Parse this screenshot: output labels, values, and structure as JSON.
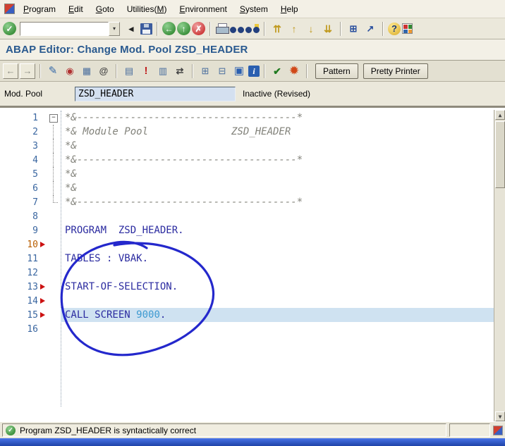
{
  "menu_bar": {
    "items": [
      {
        "label": "Program",
        "u": 0
      },
      {
        "label": "Edit",
        "u": 0
      },
      {
        "label": "Goto",
        "u": 0
      },
      {
        "label": "Utilities(M)",
        "u": 10
      },
      {
        "label": "Environment",
        "u": 0
      },
      {
        "label": "System",
        "u": 0
      },
      {
        "label": "Help",
        "u": 0
      }
    ]
  },
  "toolbar": {
    "enter_glyph": "✓",
    "command_field_value": "",
    "command_dropdown_glyph": "▾",
    "icons": [
      {
        "name": "collapse-command-field-icon",
        "glyph": "◂",
        "cls": "plain"
      },
      {
        "name": "save-icon",
        "cls": "floppy"
      },
      {
        "sep": true
      },
      {
        "name": "back-icon",
        "glyph": "←",
        "cls": "circle green"
      },
      {
        "name": "exit-icon",
        "glyph": "↑",
        "cls": "circle green"
      },
      {
        "name": "cancel-icon",
        "glyph": "✗",
        "cls": "circle red"
      },
      {
        "sep": true
      },
      {
        "name": "print-icon",
        "cls": "printer"
      },
      {
        "name": "find-icon",
        "cls": "binoc"
      },
      {
        "name": "find-next-icon",
        "cls": "binoc plus"
      },
      {
        "sep": true
      },
      {
        "name": "first-page-icon",
        "glyph": "⇈",
        "cls": "gold"
      },
      {
        "name": "previous-page-icon",
        "glyph": "↑",
        "cls": "gold"
      },
      {
        "name": "next-page-icon",
        "glyph": "↓",
        "cls": "gold"
      },
      {
        "name": "last-page-icon",
        "glyph": "⇊",
        "cls": "gold"
      },
      {
        "sep": true
      },
      {
        "name": "new-session-icon",
        "glyph": "⊞",
        "cls": "blue"
      },
      {
        "name": "create-shortcut-icon",
        "glyph": "↗",
        "cls": "blue"
      },
      {
        "sep": true
      },
      {
        "name": "help-icon",
        "glyph": "?",
        "cls": "help"
      },
      {
        "name": "customize-layout-icon",
        "cls": "grid4"
      }
    ]
  },
  "title": "ABAP Editor: Change Mod. Pool ZSD_HEADER",
  "app_toolbar": {
    "icons": [
      {
        "name": "previous-object-icon",
        "glyph": "←",
        "cls": "btnicon dim"
      },
      {
        "name": "next-object-icon",
        "glyph": "→",
        "cls": "btnicon dim"
      },
      {
        "sep": true
      },
      {
        "name": "display-change-icon",
        "glyph": "✎",
        "cls": "pen"
      },
      {
        "name": "other-object-icon",
        "glyph": "◉",
        "cls": "target"
      },
      {
        "name": "copy-icon",
        "glyph": "▦",
        "cls": "bluish"
      },
      {
        "name": "runtime-analysis-icon",
        "glyph": "@",
        "cls": "dark"
      },
      {
        "sep": true
      },
      {
        "name": "insert-block-icon",
        "glyph": "▤",
        "cls": "bluish"
      },
      {
        "name": "breakpoint-icon",
        "glyph": "!",
        "cls": "redbold"
      },
      {
        "name": "pattern-list-icon",
        "glyph": "▥",
        "cls": "bluish"
      },
      {
        "name": "compare-icon",
        "glyph": "⇄",
        "cls": "dark"
      },
      {
        "sep": true
      },
      {
        "name": "object-list-icon",
        "glyph": "⊞",
        "cls": "bluish"
      },
      {
        "name": "navigation-icon",
        "glyph": "⊟",
        "cls": "bluish"
      },
      {
        "name": "screen-painter-icon",
        "glyph": "▣",
        "cls": "screenblue"
      },
      {
        "name": "documentation-icon",
        "glyph": "i",
        "cls": "infoblue"
      },
      {
        "sep": true
      },
      {
        "name": "syntax-check-icon",
        "glyph": "✔",
        "cls": "checkred"
      },
      {
        "name": "activate-icon",
        "glyph": "✹",
        "cls": "activ"
      },
      {
        "sep": true
      }
    ],
    "pattern_label": "Pattern",
    "pretty_printer_label": "Pretty Printer"
  },
  "form": {
    "mod_pool_label": "Mod. Pool",
    "mod_pool_value": "ZSD_HEADER",
    "status": "Inactive (Revised)"
  },
  "editor": {
    "annotation_color": "#2428cc",
    "lines": [
      {
        "n": "1",
        "fold": "start",
        "segs": [
          {
            "c": "comment",
            "t": "*&-------------------------------------*"
          }
        ]
      },
      {
        "n": "2",
        "fold": "mid",
        "segs": [
          {
            "c": "comment",
            "t": "*& Module Pool              ZSD_HEADER"
          }
        ]
      },
      {
        "n": "3",
        "fold": "mid",
        "segs": [
          {
            "c": "comment",
            "t": "*&"
          }
        ]
      },
      {
        "n": "4",
        "fold": "mid",
        "segs": [
          {
            "c": "comment",
            "t": "*&-------------------------------------*"
          }
        ]
      },
      {
        "n": "5",
        "fold": "mid",
        "segs": [
          {
            "c": "comment",
            "t": "*&"
          }
        ]
      },
      {
        "n": "6",
        "fold": "mid",
        "segs": [
          {
            "c": "comment",
            "t": "*&"
          }
        ]
      },
      {
        "n": "7",
        "fold": "end",
        "segs": [
          {
            "c": "comment",
            "t": "*&-------------------------------------*"
          }
        ]
      },
      {
        "n": "8"
      },
      {
        "n": "9",
        "segs": [
          {
            "c": "kw",
            "t": "PROGRAM  ZSD_HEADER."
          }
        ]
      },
      {
        "n": "10",
        "marker": true,
        "num_color": "orange"
      },
      {
        "n": "11",
        "segs": [
          {
            "c": "kw",
            "t": "TABLES : VBAK."
          }
        ]
      },
      {
        "n": "12"
      },
      {
        "n": "13",
        "marker": true,
        "segs": [
          {
            "c": "kw",
            "t": "START-OF-SELECTION."
          }
        ]
      },
      {
        "n": "14",
        "marker": true
      },
      {
        "n": "15",
        "marker": true,
        "highlight": true,
        "segs": [
          {
            "c": "kw",
            "t": "CALL SCREEN "
          },
          {
            "c": "num",
            "t": "9000"
          },
          {
            "c": "kw",
            "t": "."
          }
        ]
      },
      {
        "n": "16"
      }
    ]
  },
  "status_bar": {
    "icon": "✓",
    "message": "Program ZSD_HEADER is syntactically correct"
  }
}
